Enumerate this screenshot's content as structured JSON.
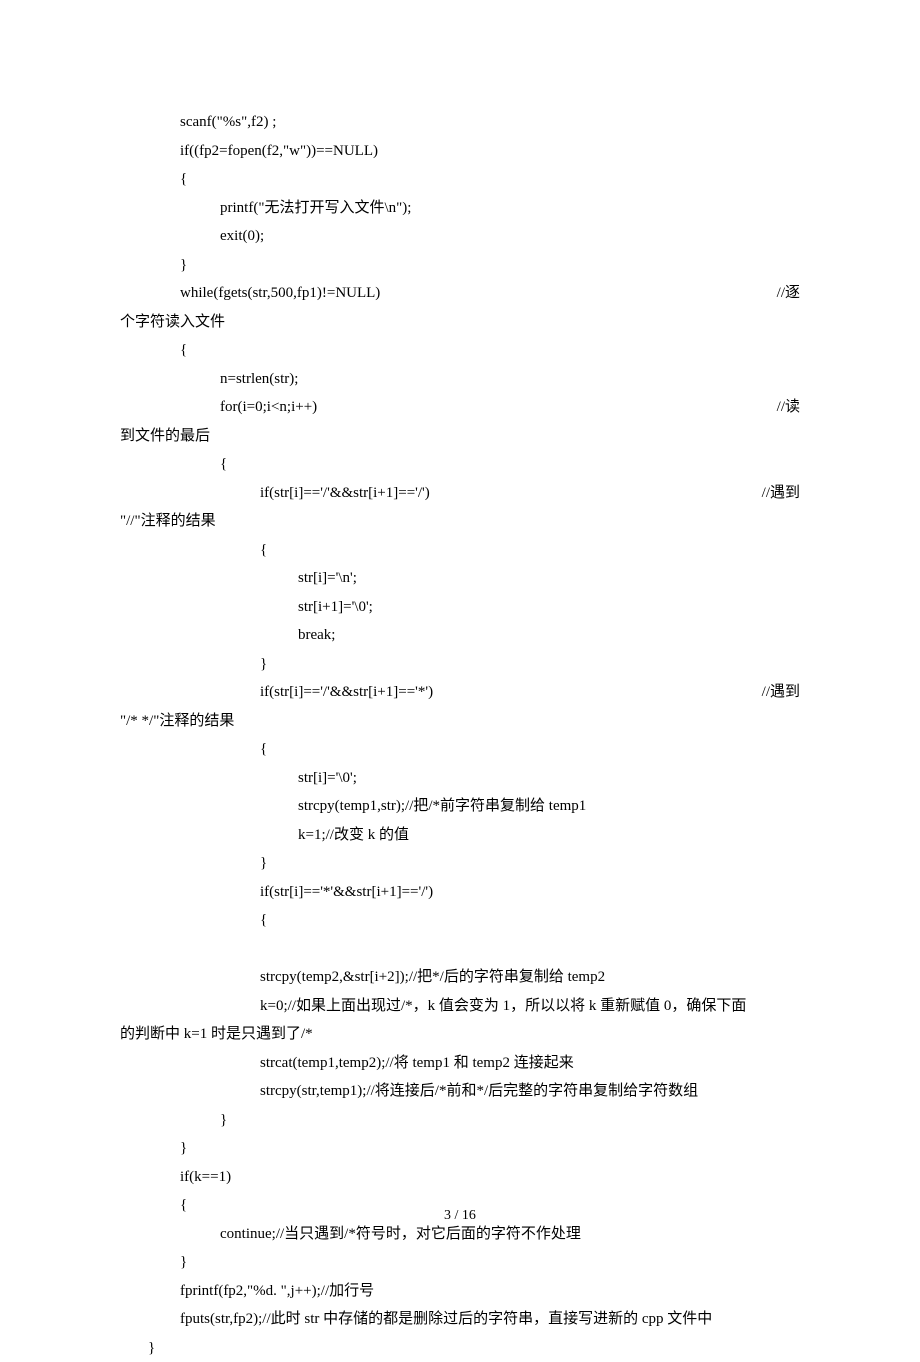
{
  "lines": [
    {
      "indent": 1,
      "left": "scanf(\"%s\",f2) ;",
      "right": ""
    },
    {
      "indent": 1,
      "left": "if((fp2=fopen(f2,\"w\"))==NULL)",
      "right": ""
    },
    {
      "indent": 1,
      "left": "{",
      "right": ""
    },
    {
      "indent": 2,
      "left": "printf(\"无法打开写入文件\\n\");",
      "right": ""
    },
    {
      "indent": 2,
      "left": "exit(0);",
      "right": ""
    },
    {
      "indent": 1,
      "left": "}",
      "right": ""
    },
    {
      "indent": 1,
      "left": "while(fgets(str,500,fp1)!=NULL)",
      "right": "//逐",
      "wrap": "个字符读入文件"
    },
    {
      "indent": 1,
      "left": "{",
      "right": ""
    },
    {
      "indent": 2,
      "left": "n=strlen(str);",
      "right": ""
    },
    {
      "indent": 2,
      "left": "for(i=0;i<n;i++)",
      "right": "//读",
      "wrap": "到文件的最后"
    },
    {
      "indent": 2,
      "left": "{",
      "right": ""
    },
    {
      "indent": 3,
      "left": "if(str[i]=='/'&&str[i+1]=='/')",
      "right": "//遇到",
      "wrap": "\"//\"注释的结果"
    },
    {
      "indent": 3,
      "left": "{",
      "right": ""
    },
    {
      "indent": 4,
      "left": "str[i]='\\n';",
      "right": ""
    },
    {
      "indent": 4,
      "left": "str[i+1]='\\0';",
      "right": ""
    },
    {
      "indent": 4,
      "left": "break;",
      "right": ""
    },
    {
      "indent": 3,
      "left": "}",
      "right": ""
    },
    {
      "indent": 3,
      "left": "if(str[i]=='/'&&str[i+1]=='*')",
      "right": "//遇到",
      "wrap": "\"/* */\"注释的结果"
    },
    {
      "indent": 3,
      "left": "{",
      "right": ""
    },
    {
      "indent": 4,
      "left": "str[i]='\\0';",
      "right": ""
    },
    {
      "indent": 4,
      "left": "strcpy(temp1,str);//把/*前字符串复制给 temp1",
      "right": ""
    },
    {
      "indent": 4,
      "left": "k=1;//改变 k 的值",
      "right": ""
    },
    {
      "indent": 3,
      "left": "}",
      "right": ""
    },
    {
      "indent": 3,
      "left": "if(str[i]=='*'&&str[i+1]=='/')",
      "right": ""
    },
    {
      "indent": 3,
      "left": "{",
      "right": ""
    },
    {
      "indent": 0,
      "left": "",
      "right": ""
    },
    {
      "indent": 3,
      "left": "strcpy(temp2,&str[i+2]);//把*/后的字符串复制给 temp2",
      "right": ""
    },
    {
      "indent": 3,
      "left": "k=0;//如果上面出现过/*，k 值会变为 1，所以以将 k 重新赋值 0，确保下面",
      "right": "",
      "wrap": "的判断中 k=1 时是只遇到了/*"
    },
    {
      "indent": 3,
      "left": "strcat(temp1,temp2);//将 temp1 和 temp2 连接起来",
      "right": ""
    },
    {
      "indent": 3,
      "left": "strcpy(str,temp1);//将连接后/*前和*/后完整的字符串复制给字符数组",
      "right": ""
    },
    {
      "indent": 2,
      "left": "}",
      "right": ""
    },
    {
      "indent": 1,
      "left": "}",
      "right": ""
    },
    {
      "indent": 1,
      "left": "if(k==1)",
      "right": ""
    },
    {
      "indent": 1,
      "left": "{",
      "right": ""
    },
    {
      "indent": 2,
      "left": "continue;//当只遇到/*符号时，对它后面的字符不作处理",
      "right": ""
    },
    {
      "indent": 1,
      "left": "}",
      "right": ""
    },
    {
      "indent": 1,
      "left": "fprintf(fp2,\"%d. \",j++);//加行号",
      "right": ""
    },
    {
      "indent": 1,
      "left": "fputs(str,fp2);//此时 str 中存储的都是删除过后的字符串，直接写进新的 cpp 文件中",
      "right": ""
    },
    {
      "indent": 0,
      "left": "}",
      "right": ""
    }
  ],
  "footer": "3  /  16"
}
